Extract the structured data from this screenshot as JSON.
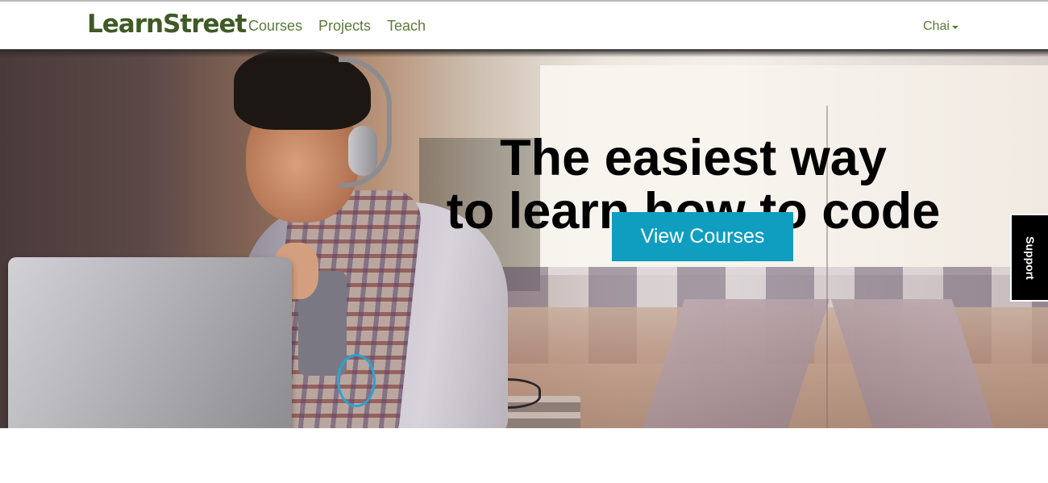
{
  "nav": {
    "logo": "LearnStreet",
    "links": [
      "Courses",
      "Projects",
      "Teach"
    ],
    "user_name": "Chai"
  },
  "hero": {
    "headline_line1": "The easiest way",
    "headline_line2": "to learn how to code",
    "cta_label": "View Courses",
    "image_subject": "student with headphones working on laptop in library"
  },
  "support_tab": {
    "label": "Support"
  },
  "colors": {
    "brand_green": "#3f5a25",
    "nav_link_green": "#5a7a38",
    "cta_blue": "#0f9ec0",
    "support_bg": "#000000"
  },
  "icons": {
    "user_menu_caret": "chevron-down-icon"
  }
}
